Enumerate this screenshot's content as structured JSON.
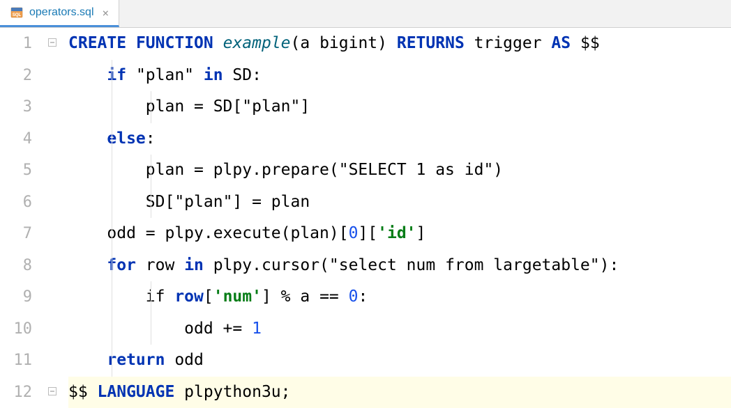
{
  "tab": {
    "filename": "operators.sql",
    "close": "×"
  },
  "lines": [
    "1",
    "2",
    "3",
    "4",
    "5",
    "6",
    "7",
    "8",
    "9",
    "10",
    "11",
    "12"
  ],
  "code": {
    "l1": {
      "kw1": "CREATE",
      "kw2": "FUNCTION",
      "fn": "example",
      "params": "(a bigint) ",
      "kw3": "RETURNS",
      "ret": " trigger ",
      "kw4": "AS",
      "dollar": " $$"
    },
    "l2": {
      "indent": "    ",
      "kw": "if",
      "str": " \"plan\" ",
      "kw2": "in",
      "rest": " SD:"
    },
    "l3": {
      "indent": "        plan = SD[",
      "str": "\"plan\"",
      "close": "]"
    },
    "l4": {
      "indent": "    ",
      "kw": "else",
      "colon": ":"
    },
    "l5": {
      "indent": "        plan = plpy.prepare(",
      "str": "\"SELECT 1 as id\"",
      "close": ")"
    },
    "l6": {
      "indent": "        SD[",
      "str": "\"plan\"",
      "rest": "] = plan"
    },
    "l7": {
      "indent": "    odd = plpy.execute(plan)[",
      "num": "0",
      "mid": "][",
      "str": "'id'",
      "close": "]"
    },
    "l8": {
      "indent": "    ",
      "kw1": "for",
      "mid1": " row ",
      "kw2": "in",
      "mid2": " plpy.cursor(",
      "str": "\"select num from largetable\"",
      "close": "):"
    },
    "l9": {
      "indent": "        if ",
      "kw": "row",
      "bracket": "[",
      "str": "'num'",
      "rest": "] % a == ",
      "num": "0",
      "colon": ":"
    },
    "l10": {
      "indent": "            odd += ",
      "num": "1"
    },
    "l11": {
      "indent": "    ",
      "kw": "return",
      "rest": " odd"
    },
    "l12": {
      "dollar": "$$ ",
      "kw": "LANGUAGE",
      "lang": " plpython3u;"
    }
  }
}
